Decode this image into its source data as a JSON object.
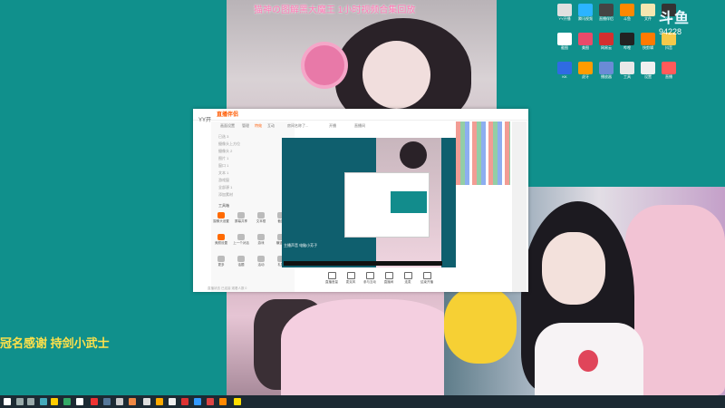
{
  "stream_banner": "猫神の图解黑大魔王 1小时视频合集回放",
  "danmaku_text": "冠名感谢 持剑小武士",
  "clock_widget": {
    "logo": "斗鱼",
    "time": "94228"
  },
  "desktop_icons": [
    {
      "label": "YY开播",
      "color": "#e0e0e0"
    },
    {
      "label": "腾讯视频",
      "color": "#2bb4ff"
    },
    {
      "label": "直播伴侣",
      "color": "#444"
    },
    {
      "label": "斗鱼",
      "color": "#ff8800"
    },
    {
      "label": "文件",
      "color": "#f5e6b0"
    },
    {
      "label": "OBS",
      "color": "#333"
    },
    {
      "label": "截图",
      "color": "#ffffff"
    },
    {
      "label": "美图",
      "color": "#e94b6a"
    },
    {
      "label": "网易云",
      "color": "#d32f2f"
    },
    {
      "label": "哔哩",
      "color": "#222"
    },
    {
      "label": "快剪辑",
      "color": "#ff7a00"
    },
    {
      "label": "抖音",
      "color": "#f6c94a"
    },
    {
      "label": "KK",
      "color": "#2f6be3"
    },
    {
      "label": "虎牙",
      "color": "#ff9c00"
    },
    {
      "label": "播放器",
      "color": "#6a8bd6"
    },
    {
      "label": "工具",
      "color": "#e8e8e8"
    },
    {
      "label": "设置",
      "color": "#f0f0f0"
    },
    {
      "label": "直播",
      "color": "#ff5a5a"
    }
  ],
  "yy_app": {
    "logo": "直播伴侣",
    "ylogo": "YY开",
    "tabs": [
      "画面设置",
      "管理",
      "特效",
      "互动"
    ],
    "room_tabs": [
      "房间名称了...",
      "开播",
      "直播间"
    ],
    "sources": [
      "已选 3 ",
      "摄像头上方位",
      "摄像头 2",
      "图片 1",
      "窗口 1",
      "文本 1",
      "游戏窗",
      "全部源 1",
      "添加素材"
    ],
    "tools_label": "工具箱",
    "tools": [
      {
        "label": "摄像头设置",
        "highlight": true
      },
      {
        "label": "屏幕共享",
        "highlight": false
      },
      {
        "label": "文本框",
        "highlight": false
      },
      {
        "label": "截图",
        "highlight": false
      },
      {
        "label": "美颜设置",
        "highlight": true
      },
      {
        "label": "上一个对话",
        "highlight": false
      },
      {
        "label": "游戏",
        "highlight": false
      },
      {
        "label": "横竖屏",
        "highlight": false
      },
      {
        "label": "更多",
        "highlight": false
      },
      {
        "label": "话题",
        "highlight": false
      },
      {
        "label": "活动",
        "highlight": false
      },
      {
        "label": "礼物",
        "highlight": false
      }
    ],
    "preview_caption": "主播声音 电脑小芳子",
    "controls": [
      "直播音量",
      "麦克风",
      "参与互动",
      "直播间",
      "连麦",
      "结束开播"
    ],
    "status": "直播状态 已连接 观看人数 0"
  }
}
